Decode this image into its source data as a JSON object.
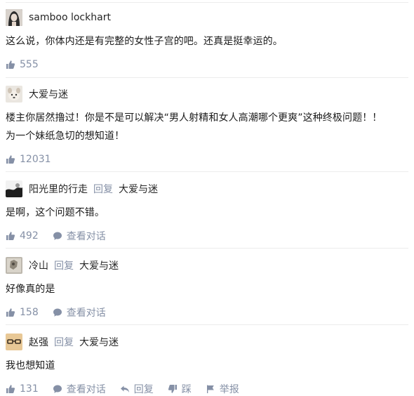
{
  "comments": [
    {
      "author": "samboo lockhart",
      "reply_label": "",
      "reply_to": "",
      "lines": [
        "这么说，你体内还是有完整的女性子宫的吧。还真是挺幸运的。"
      ],
      "likes": "555",
      "actions": {}
    },
    {
      "author": "大爱与迷",
      "reply_label": "",
      "reply_to": "",
      "lines": [
        "楼主你居然撸过！你是不是可以解决“男人射精和女人高潮哪个更爽”这种终极问题！！",
        "为一个妹纸急切的想知道！"
      ],
      "likes": "12031",
      "actions": {}
    },
    {
      "author": "阳光里的行走",
      "reply_label": "回复",
      "reply_to": "大爱与迷",
      "lines": [
        "是啊，这个问题不错。"
      ],
      "likes": "492",
      "actions": {
        "view_conversation": "查看对话"
      }
    },
    {
      "author": "冷山",
      "reply_label": "回复",
      "reply_to": "大爱与迷",
      "lines": [
        "好像真的是"
      ],
      "likes": "158",
      "actions": {
        "view_conversation": "查看对话"
      }
    },
    {
      "author": "赵强",
      "reply_label": "回复",
      "reply_to": "大爱与迷",
      "lines": [
        "我也想知道"
      ],
      "likes": "131",
      "actions": {
        "view_conversation": "查看对话",
        "reply": "回复",
        "dislike": "踩",
        "report": "举报"
      }
    }
  ],
  "icons": {
    "like": "thumbs-up-icon",
    "conversation": "speech-bubble-icon",
    "reply": "reply-arrow-icon",
    "dislike": "thumbs-down-icon",
    "report": "flag-icon"
  },
  "colors": {
    "meta_text": "#8590a6",
    "body_text": "#1a1a1a",
    "divider": "#ececec"
  }
}
